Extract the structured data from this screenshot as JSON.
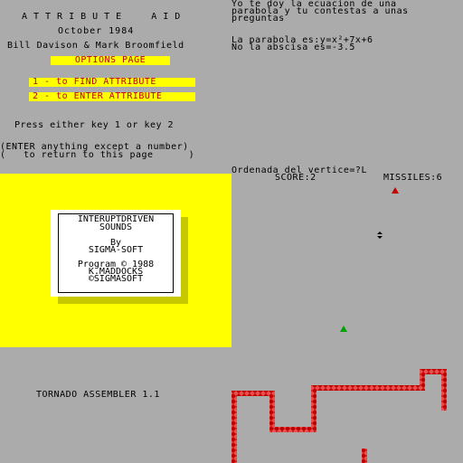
{
  "left_menu": {
    "title": "ATTRIBUTE  AID",
    "date": "October 1984",
    "authors": "Bill Davison & Mark Broomfield",
    "options_heading": "OPTIONS PAGE",
    "option1": "1 - to FIND ATTRIBUTE",
    "option2": "2 - to ENTER ATTRIBUTE",
    "prompt": "Press either key 1 or key 2",
    "hint_line1": "(ENTER anything except a number)",
    "hint_line2": "(   to return to this page      )"
  },
  "quiz": {
    "line1": "Yo te doy la ecuacion de una",
    "line2": "parabola y tu contestas a unas",
    "line3": "preguntas",
    "equation": "La parabola es:y=x²+7x+6",
    "abscissa": "No la abscisa es=-3.5",
    "ordinate_prompt": "Ordenada del vertice=?L"
  },
  "game": {
    "score_label": "SCORE:2",
    "missiles_label": "MISSILES:6",
    "colors": {
      "track": "#c00000",
      "player": "#00a000",
      "enemy": "#c00000"
    }
  },
  "sounds_card": {
    "line1": "INTERUPTDRIVEN",
    "line2": "SOUNDS",
    "line3": "By",
    "line4": "SIGMA-SOFT",
    "line5": "Program © 1988",
    "line6": "K.MADDOCKS",
    "line7": "©SIGMASOFT"
  },
  "assembler": {
    "title": "TORNADO ASSEMBLER 1.1"
  }
}
